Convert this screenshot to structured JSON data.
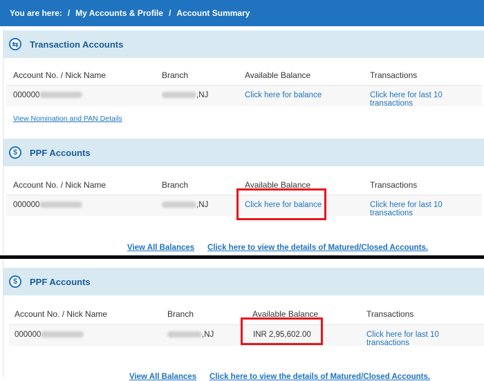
{
  "breadcrumb": {
    "prefix": "You are here:",
    "sep": "/",
    "item1": "My Accounts & Profile",
    "item2": "Account Summary"
  },
  "transaction": {
    "title": "Transaction Accounts",
    "cols": [
      "Account No. / Nick Name",
      "Branch",
      "Available Balance",
      "Transactions"
    ],
    "acct_prefix": "000000",
    "branch_suffix": ",NJ",
    "balance_link": "Click here for balance",
    "txn_link": "Click here for last 10 transactions",
    "nomination_link": "View Nomination and PAN Details"
  },
  "ppf1": {
    "title": "PPF Accounts",
    "cols": [
      "Account No. / Nick Name",
      "Branch",
      "Available Balance",
      "Transactions"
    ],
    "acct_prefix": "000000",
    "branch_suffix": ",NJ",
    "balance_link": "Click here for balance",
    "txn_link": "Click here for last 10 transactions",
    "view_all": "View All Balances",
    "matured": "Click here to view the details of Matured/Closed Accounts."
  },
  "ppf2": {
    "title": "PPF Accounts",
    "cols": [
      "Account No. / Nick Name",
      "Branch",
      "Available Balance",
      "Transactions"
    ],
    "acct_prefix": "000000",
    "branch_suffix": ",NJ",
    "balance_value": "INR 2,95,602.00",
    "txn_link": "Click here for last 10 transactions",
    "view_all": "View All Balances",
    "matured": "Click here to view the details of Matured/Closed Accounts."
  },
  "colors": {
    "brand": "#1f73bf",
    "panel_head": "#d9e9f2",
    "highlight": "#e8141b"
  },
  "icons": {
    "transaction": "wallet-icon",
    "ppf": "money-bag-icon"
  }
}
